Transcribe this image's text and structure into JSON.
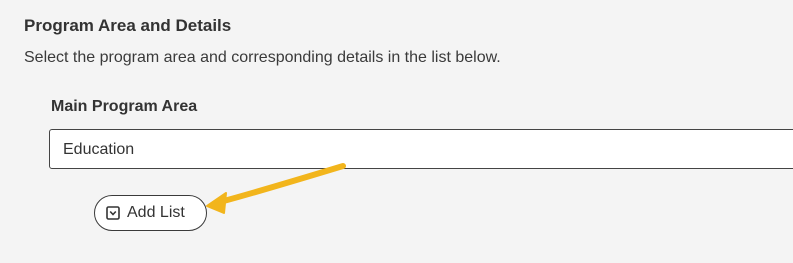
{
  "section": {
    "title": "Program Area and Details",
    "description": "Select the program area and corresponding details in the list below."
  },
  "field": {
    "label": "Main Program Area",
    "selected_value": "Education"
  },
  "add_list_button": {
    "label": "Add List",
    "icon": "list-box-icon"
  },
  "annotation": {
    "arrow_color": "#f2b51c",
    "icon": "pointer-arrow"
  }
}
